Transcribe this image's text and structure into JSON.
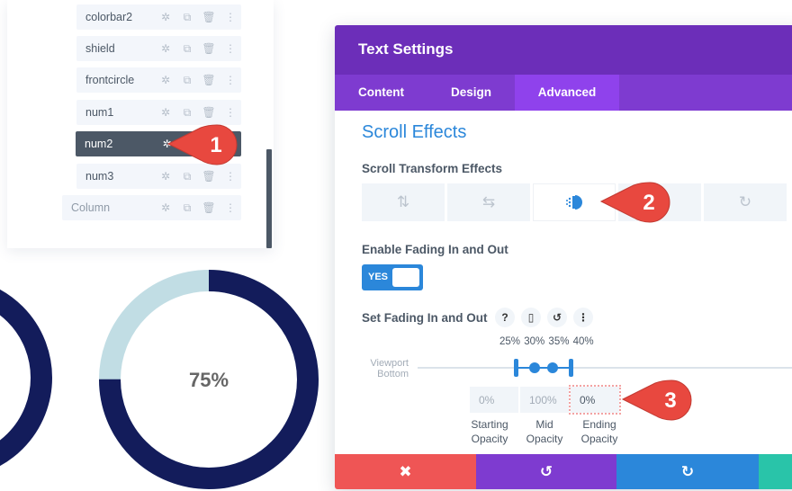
{
  "layers": {
    "items": [
      {
        "label": "colorbar2",
        "state": "normal"
      },
      {
        "label": "shield",
        "state": "normal"
      },
      {
        "label": "frontcircle",
        "state": "normal"
      },
      {
        "label": "num1",
        "state": "normal"
      },
      {
        "label": "num2",
        "state": "active"
      },
      {
        "label": "num3",
        "state": "normal"
      },
      {
        "label": "Column",
        "state": "column"
      }
    ],
    "icons": [
      "gear-icon",
      "duplicate-icon",
      "trash-icon",
      "more-icon"
    ]
  },
  "circle_counter": {
    "value_label": "75%",
    "percent": 75,
    "fill_color": "#131c5b",
    "track_color": "#c1dde4"
  },
  "modal": {
    "title": "Text Settings",
    "tabs": [
      {
        "label": "Content",
        "active": false
      },
      {
        "label": "Design",
        "active": false
      },
      {
        "label": "Advanced",
        "active": true
      }
    ],
    "section_title": "Scroll Effects",
    "scroll_transform_label": "Scroll Transform Effects",
    "effects": [
      {
        "icon": "vertical-motion-icon",
        "glyph": "⇅",
        "active": false
      },
      {
        "icon": "horizontal-motion-icon",
        "glyph": "⇆",
        "active": false
      },
      {
        "icon": "fade-icon",
        "glyph": "",
        "active": true
      },
      {
        "icon": "scale-icon",
        "glyph": "",
        "active": false
      },
      {
        "icon": "rotate-icon",
        "glyph": "↻",
        "active": false
      }
    ],
    "enable_fading_label": "Enable Fading In and Out",
    "toggle_label": "YES",
    "toggle_on": true,
    "set_fading_label": "Set Fading In and Out",
    "help_icons": [
      "?",
      "▯",
      "↺",
      "⋮"
    ],
    "viewport_label_line1": "Viewport",
    "viewport_label_line2": "Bottom",
    "range_percent_labels": "25% 30% 35% 40%",
    "range_points": [
      25,
      30,
      35,
      40
    ],
    "opacity": {
      "starting": {
        "value": "0%",
        "label_line1": "Starting",
        "label_line2": "Opacity"
      },
      "mid": {
        "value": "100%",
        "label_line1": "Mid",
        "label_line2": "Opacity"
      },
      "ending": {
        "value": "0%",
        "label_line1": "Ending",
        "label_line2": "Opacity"
      }
    },
    "footer": {
      "cancel_glyph": "✖",
      "undo_glyph": "↺",
      "redo_glyph": "↻",
      "colors": {
        "cancel": "#ef5555",
        "undo": "#7e3bd0",
        "redo": "#2b87da",
        "save": "#29c4a9"
      }
    }
  },
  "callouts": [
    {
      "number": "1"
    },
    {
      "number": "2"
    },
    {
      "number": "3"
    }
  ],
  "colors": {
    "accent_blue": "#2b87da",
    "header_purple": "#6c2eb9",
    "tab_purple": "#7e3bd0",
    "callout_red": "#e8483f"
  }
}
